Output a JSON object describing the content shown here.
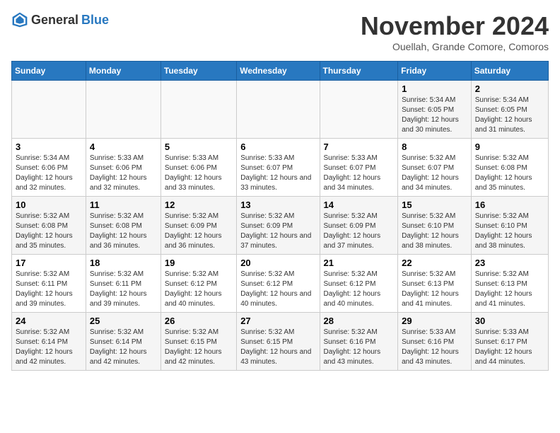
{
  "header": {
    "logo_general": "General",
    "logo_blue": "Blue",
    "month_title": "November 2024",
    "location": "Ouellah, Grande Comore, Comoros"
  },
  "weekdays": [
    "Sunday",
    "Monday",
    "Tuesday",
    "Wednesday",
    "Thursday",
    "Friday",
    "Saturday"
  ],
  "weeks": [
    [
      {
        "day": "",
        "info": ""
      },
      {
        "day": "",
        "info": ""
      },
      {
        "day": "",
        "info": ""
      },
      {
        "day": "",
        "info": ""
      },
      {
        "day": "",
        "info": ""
      },
      {
        "day": "1",
        "info": "Sunrise: 5:34 AM\nSunset: 6:05 PM\nDaylight: 12 hours and 30 minutes."
      },
      {
        "day": "2",
        "info": "Sunrise: 5:34 AM\nSunset: 6:05 PM\nDaylight: 12 hours and 31 minutes."
      }
    ],
    [
      {
        "day": "3",
        "info": "Sunrise: 5:34 AM\nSunset: 6:06 PM\nDaylight: 12 hours and 32 minutes."
      },
      {
        "day": "4",
        "info": "Sunrise: 5:33 AM\nSunset: 6:06 PM\nDaylight: 12 hours and 32 minutes."
      },
      {
        "day": "5",
        "info": "Sunrise: 5:33 AM\nSunset: 6:06 PM\nDaylight: 12 hours and 33 minutes."
      },
      {
        "day": "6",
        "info": "Sunrise: 5:33 AM\nSunset: 6:07 PM\nDaylight: 12 hours and 33 minutes."
      },
      {
        "day": "7",
        "info": "Sunrise: 5:33 AM\nSunset: 6:07 PM\nDaylight: 12 hours and 34 minutes."
      },
      {
        "day": "8",
        "info": "Sunrise: 5:32 AM\nSunset: 6:07 PM\nDaylight: 12 hours and 34 minutes."
      },
      {
        "day": "9",
        "info": "Sunrise: 5:32 AM\nSunset: 6:08 PM\nDaylight: 12 hours and 35 minutes."
      }
    ],
    [
      {
        "day": "10",
        "info": "Sunrise: 5:32 AM\nSunset: 6:08 PM\nDaylight: 12 hours and 35 minutes."
      },
      {
        "day": "11",
        "info": "Sunrise: 5:32 AM\nSunset: 6:08 PM\nDaylight: 12 hours and 36 minutes."
      },
      {
        "day": "12",
        "info": "Sunrise: 5:32 AM\nSunset: 6:09 PM\nDaylight: 12 hours and 36 minutes."
      },
      {
        "day": "13",
        "info": "Sunrise: 5:32 AM\nSunset: 6:09 PM\nDaylight: 12 hours and 37 minutes."
      },
      {
        "day": "14",
        "info": "Sunrise: 5:32 AM\nSunset: 6:09 PM\nDaylight: 12 hours and 37 minutes."
      },
      {
        "day": "15",
        "info": "Sunrise: 5:32 AM\nSunset: 6:10 PM\nDaylight: 12 hours and 38 minutes."
      },
      {
        "day": "16",
        "info": "Sunrise: 5:32 AM\nSunset: 6:10 PM\nDaylight: 12 hours and 38 minutes."
      }
    ],
    [
      {
        "day": "17",
        "info": "Sunrise: 5:32 AM\nSunset: 6:11 PM\nDaylight: 12 hours and 39 minutes."
      },
      {
        "day": "18",
        "info": "Sunrise: 5:32 AM\nSunset: 6:11 PM\nDaylight: 12 hours and 39 minutes."
      },
      {
        "day": "19",
        "info": "Sunrise: 5:32 AM\nSunset: 6:12 PM\nDaylight: 12 hours and 40 minutes."
      },
      {
        "day": "20",
        "info": "Sunrise: 5:32 AM\nSunset: 6:12 PM\nDaylight: 12 hours and 40 minutes."
      },
      {
        "day": "21",
        "info": "Sunrise: 5:32 AM\nSunset: 6:12 PM\nDaylight: 12 hours and 40 minutes."
      },
      {
        "day": "22",
        "info": "Sunrise: 5:32 AM\nSunset: 6:13 PM\nDaylight: 12 hours and 41 minutes."
      },
      {
        "day": "23",
        "info": "Sunrise: 5:32 AM\nSunset: 6:13 PM\nDaylight: 12 hours and 41 minutes."
      }
    ],
    [
      {
        "day": "24",
        "info": "Sunrise: 5:32 AM\nSunset: 6:14 PM\nDaylight: 12 hours and 42 minutes."
      },
      {
        "day": "25",
        "info": "Sunrise: 5:32 AM\nSunset: 6:14 PM\nDaylight: 12 hours and 42 minutes."
      },
      {
        "day": "26",
        "info": "Sunrise: 5:32 AM\nSunset: 6:15 PM\nDaylight: 12 hours and 42 minutes."
      },
      {
        "day": "27",
        "info": "Sunrise: 5:32 AM\nSunset: 6:15 PM\nDaylight: 12 hours and 43 minutes."
      },
      {
        "day": "28",
        "info": "Sunrise: 5:32 AM\nSunset: 6:16 PM\nDaylight: 12 hours and 43 minutes."
      },
      {
        "day": "29",
        "info": "Sunrise: 5:33 AM\nSunset: 6:16 PM\nDaylight: 12 hours and 43 minutes."
      },
      {
        "day": "30",
        "info": "Sunrise: 5:33 AM\nSunset: 6:17 PM\nDaylight: 12 hours and 44 minutes."
      }
    ]
  ]
}
